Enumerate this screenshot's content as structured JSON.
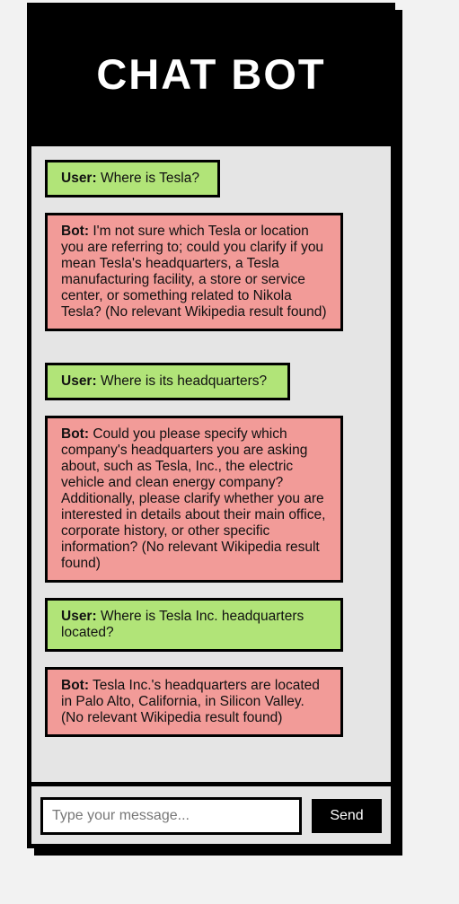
{
  "header": {
    "title": "CHAT BOT"
  },
  "messages": [
    {
      "role": "user",
      "speaker": "User:",
      "text": "Where is Tesla?"
    },
    {
      "role": "bot",
      "speaker": "Bot:",
      "text": "I'm not sure which Tesla or location you are referring to; could you clarify if you mean Tesla's headquarters, a Tesla manufacturing facility, a store or service center, or something related to Nikola Tesla? (No relevant Wikipedia result found)"
    },
    {
      "role": "user",
      "speaker": "User:",
      "text": "Where is its headquarters?"
    },
    {
      "role": "bot",
      "speaker": "Bot:",
      "text": "Could you please specify which company's headquarters you are asking about, such as Tesla, Inc., the electric vehicle and clean energy company? Additionally, please clarify whether you are interested in details about their main office, corporate history, or other specific information? (No relevant Wikipedia result found)"
    },
    {
      "role": "user",
      "speaker": "User:",
      "text": "Where is Tesla Inc. headquarters located?"
    },
    {
      "role": "bot",
      "speaker": "Bot:",
      "text": "Tesla Inc.'s headquarters are located in Palo Alto, California, in Silicon Valley. (No relevant Wikipedia result found)"
    }
  ],
  "composer": {
    "placeholder": "Type your message...",
    "value": "",
    "send_label": "Send"
  },
  "colors": {
    "user_bubble": "#b1e478",
    "bot_bubble": "#f29b98",
    "panel_bg": "#e5e5e5",
    "frame": "#000000"
  }
}
